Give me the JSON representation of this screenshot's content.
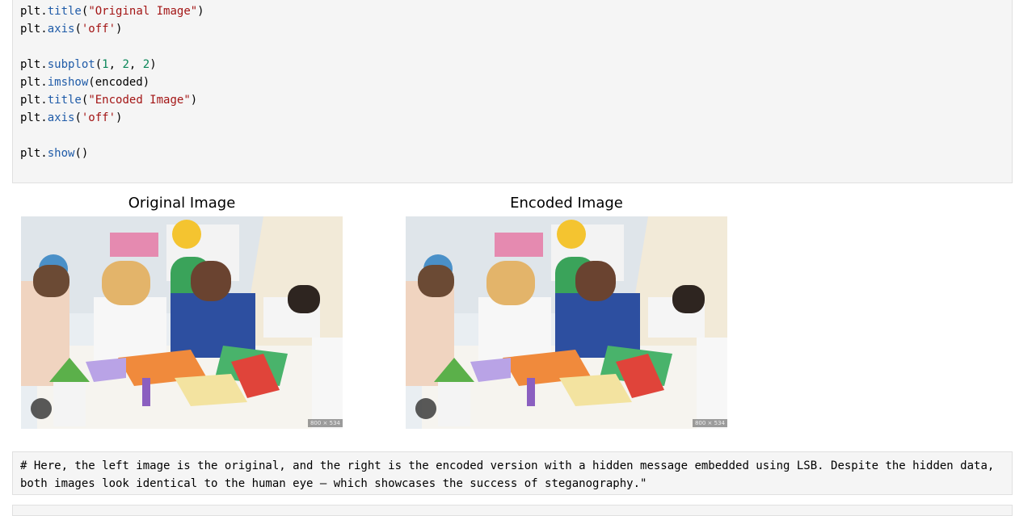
{
  "code_cell": {
    "lines": [
      "plt.title(\"Original Image\")",
      "plt.axis('off')",
      "",
      "plt.subplot(1, 2, 2)",
      "plt.imshow(encoded)",
      "plt.title(\"Encoded Image\")",
      "plt.axis('off')",
      "",
      "plt.show()"
    ]
  },
  "figure": {
    "left_title": "Original Image",
    "right_title": "Encoded Image",
    "size_badge": "800 × 534"
  },
  "markdown_cell": {
    "text": "# Here, the left image is the original, and the right is the encoded version with a hidden message embedded using LSB. Despite the hidden data, both images look identical to the human eye — which showcases the success of steganography.\""
  },
  "colors": {
    "cell_bg": "#f5f5f5",
    "function": "#1f5ba8",
    "string": "#a31515",
    "number": "#098658"
  },
  "icons": [
    "camera-lens-icon"
  ]
}
